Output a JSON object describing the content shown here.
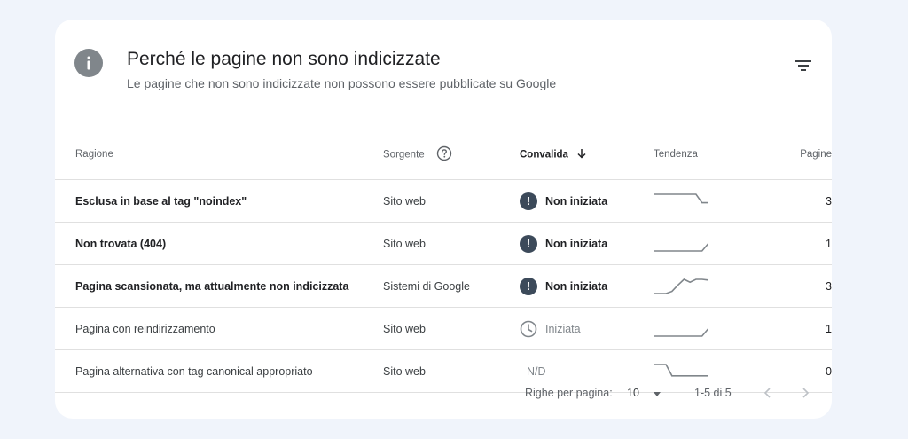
{
  "header": {
    "title": "Perché le pagine non sono indicizzate",
    "subtitle": "Le pagine che non sono indicizzate non possono essere pubblicate su Google",
    "info_icon": "info-icon",
    "filter_icon": "filter-icon"
  },
  "table": {
    "columns": {
      "reason": "Ragione",
      "source": "Sorgente",
      "validation": "Convalida",
      "trend": "Tendenza",
      "pages": "Pagine"
    },
    "rows": [
      {
        "reason": "Esclusa in base al tag \"noindex\"",
        "source": "Sito web",
        "status": "Non iniziata",
        "status_icon": "exclamation-icon",
        "pages": "3",
        "trend": [
          1,
          1,
          1,
          1,
          1,
          1,
          1,
          1,
          0.4,
          0.4
        ]
      },
      {
        "reason": "Non trovata (404)",
        "source": "Sito web",
        "status": "Non iniziata",
        "status_icon": "exclamation-icon",
        "pages": "1",
        "trend": [
          0,
          0,
          0,
          0,
          0,
          0,
          0,
          0,
          0,
          0.5
        ]
      },
      {
        "reason": "Pagina scansionata, ma attualmente non indicizzata",
        "source": "Sistemi di Google",
        "status": "Non iniziata",
        "status_icon": "exclamation-icon",
        "pages": "3",
        "trend": [
          0,
          0,
          0,
          0.15,
          0.6,
          1,
          0.8,
          1,
          1,
          0.95
        ]
      },
      {
        "reason": "Pagina con reindirizzamento",
        "source": "Sito web",
        "status": "Iniziata",
        "status_icon": "clock-icon",
        "pages": "1",
        "trend": [
          0,
          0,
          0,
          0,
          0,
          0,
          0,
          0,
          0,
          0.5
        ]
      },
      {
        "reason": "Pagina alternativa con tag canonical appropriato",
        "source": "Sito web",
        "status": "N/D",
        "status_icon": "",
        "pages": "0",
        "trend": [
          1,
          1,
          1,
          0.2,
          0.2,
          0.2,
          0.2,
          0.2,
          0.2,
          0.2
        ]
      }
    ]
  },
  "footer": {
    "rows_per_page_label": "Righe per pagina:",
    "rows_per_page_value": "10",
    "range": "1-5 di 5"
  },
  "colors": {
    "background": "#f0f4fb",
    "card": "#ffffff",
    "status_dark": "#3c4a5a",
    "spark": "#80868b"
  }
}
